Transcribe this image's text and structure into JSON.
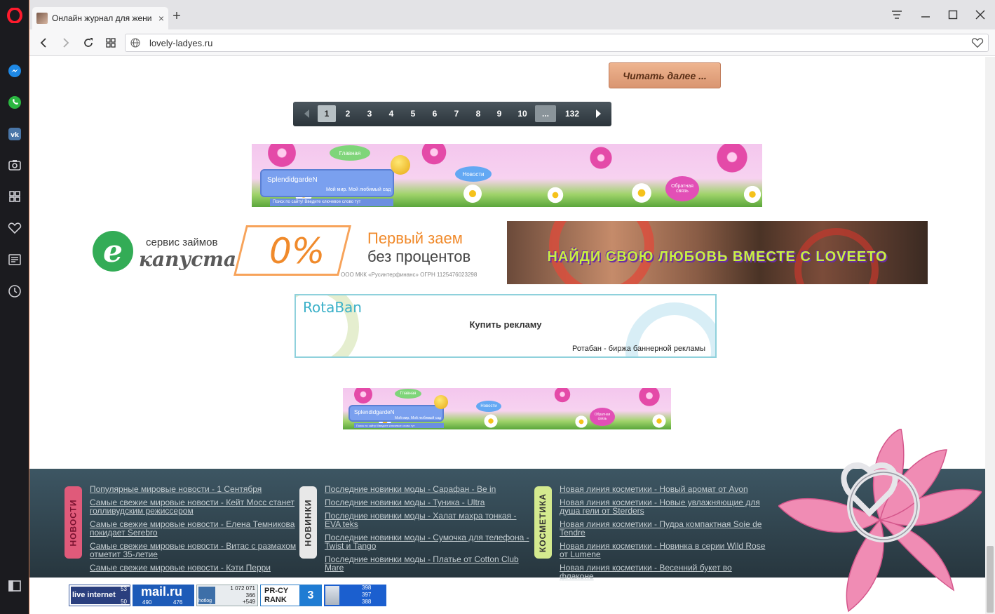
{
  "browser": {
    "tab_title": "Онлайн журнал для жени",
    "tab_close": "×",
    "new_tab": "+",
    "url": "lovely-ladyes.ru"
  },
  "content": {
    "read_more": "Читать далее ...",
    "pagination": {
      "pages": [
        "1",
        "2",
        "3",
        "4",
        "5",
        "6",
        "7",
        "8",
        "9",
        "10",
        "...",
        "132"
      ],
      "active": "1"
    },
    "banner1": {
      "brand": "SplendidgardeN",
      "tagline": "Мой мир. Мой любимый сад",
      "search": "Поиск по сайту! Введите ключевое слово тут",
      "nav_home": "Главная",
      "nav_news": "Новости",
      "nav_feedback": "Обратная связь"
    },
    "ekapusta": {
      "service": "сервис займов",
      "brand": "капуста",
      "percent": "0%",
      "headline1": "Первый заем",
      "headline2": "без процентов",
      "legal": "ООО МКК «Русинтерфинанс» ОГРН 1125476023298"
    },
    "loveeto": {
      "text": "НАЙДИ СВОЮ ЛЮБОВЬ ВМЕСТЕ С LOVEETO"
    },
    "rotaban": {
      "logo": "RotaBan",
      "buy": "Купить рекламу",
      "sub": "Ротабан - биржа баннерной рекламы"
    }
  },
  "footer": {
    "columns": [
      {
        "tab": "НОВОСТИ",
        "color": "#e05a7a",
        "links": [
          "Популярные мировые новости - 1 Сентября",
          "Самые свежие мировые новости - Кейт Мосс станет голливудским режиссером",
          "Самые свежие мировые новости - Елена Темникова покидает Serebro",
          "Самые свежие мировые новости - Витас с размахом отметит 35-летие",
          "Самые свежие мировые новости - Кэти Перри"
        ]
      },
      {
        "tab": "НОВИНКИ",
        "color": "#e8e8e8",
        "links": [
          "Последние новинки моды - Сарафан - Be in",
          "Последние новинки моды - Туника - Ultra",
          "Последние новинки моды - Халат махра тонкая - EVA teks",
          "Последние новинки моды - Сумочка для телефона - Twist и Tango",
          "Последние новинки моды - Платье от Cotton Club Mare"
        ]
      },
      {
        "tab": "КОСМЕТИКА",
        "color": "#d4ea8f",
        "links": [
          "Новая линия косметики - Новый аромат от Avon",
          "Новая линия косметики - Новые увлажняющие для душа гели от Sterders",
          "Новая линия косметики - Пудра компактная Soie de Tendre",
          "Новая линия косметики - Новинка в серии Wild Rose от Lumene",
          "Новая линия косметики - Весенний букет во флаконе"
        ]
      }
    ]
  },
  "counters": {
    "liveinternet": {
      "label": "live internet",
      "n1": "53",
      "n2": "50"
    },
    "mailru": {
      "label": "mail.ru",
      "n1": "490",
      "n2": "476"
    },
    "hotlog": {
      "label": "hotlog",
      "n1": "1 072 071",
      "n2": "366",
      "n3": "+549"
    },
    "prcy": {
      "label1": "PR-CY",
      "label2": "RANK",
      "rank": "3"
    },
    "stat": {
      "n1": "398",
      "n2": "397",
      "n3": "388"
    }
  }
}
